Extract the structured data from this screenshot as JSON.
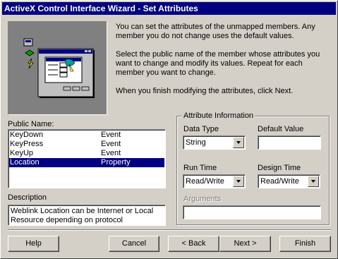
{
  "window": {
    "title": "ActiveX Control Interface Wizard - Set Attributes"
  },
  "intro": {
    "p1": "You can set the attributes of the unmapped members.  Any member you do not change uses the default values.",
    "p2": "Select the public name of the member whose attributes you want to change and modify its values. Repeat for each member you want to change.",
    "p3": "When you finish modifying the attributes, click Next."
  },
  "public_name": {
    "label": "Public Name:",
    "items": [
      {
        "name": "KeyDown",
        "type": "Event"
      },
      {
        "name": "KeyPress",
        "type": "Event"
      },
      {
        "name": "KeyUp",
        "type": "Event"
      },
      {
        "name": "Location",
        "type": "Property",
        "selected": true
      }
    ]
  },
  "description": {
    "label": "Description",
    "text": "Weblink Location can be Internet or Local Resource depending on protocol"
  },
  "attributes": {
    "legend": "Attribute Information",
    "data_type": {
      "label": "Data Type",
      "value": "String"
    },
    "default_value": {
      "label": "Default Value",
      "value": ""
    },
    "run_time": {
      "label": "Run Time",
      "value": "Read/Write"
    },
    "design_time": {
      "label": "Design Time",
      "value": "Read/Write"
    },
    "arguments": {
      "label": "Arguments",
      "value": ""
    }
  },
  "buttons": {
    "help": "Help",
    "cancel": "Cancel",
    "back": "< Back",
    "next": "Next >",
    "finish": "Finish"
  },
  "icons": [
    "wizard-illustration",
    "combo-arrow-icon"
  ]
}
